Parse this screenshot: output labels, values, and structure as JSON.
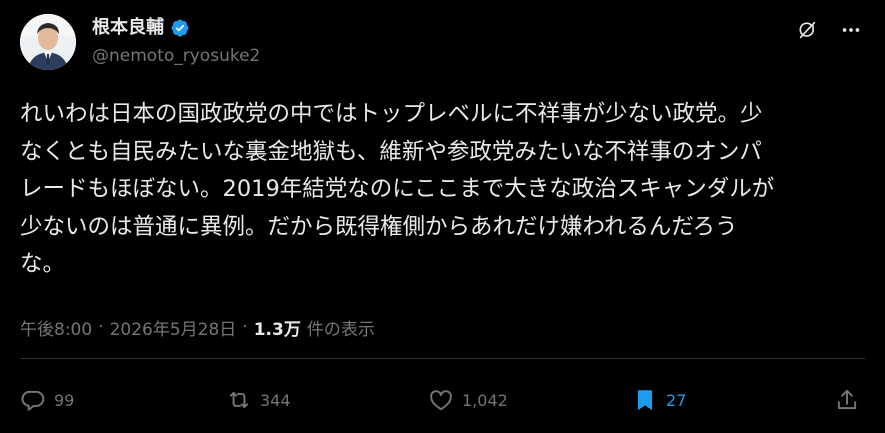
{
  "author": {
    "display_name": "根本良輔",
    "handle": "@nemoto_ryosuke2",
    "verified": true
  },
  "icons": {
    "more": "more-horizontal-icon",
    "grok": "grok-icon"
  },
  "tweet": {
    "text": "れいわは日本の国政政党の中ではトップレベルに不祥事が少ない政党。少\nなくとも自民みたいな裏金地獄も、維新や参政党みたいな不祥事のオンパ\nレードもほぼない。2019年結党なのにここまで大きな政治スキャンダルが\n少ないのは普通に異例。だから既得権側からあれだけ嫌われるんだろう\nな。"
  },
  "meta": {
    "time": "午後8:00",
    "separator1": "·",
    "date": "2026年5月28日",
    "separator2": "·",
    "views_count": "1.3万",
    "views_label": "件の表示"
  },
  "actions": {
    "replies": "99",
    "retweets": "344",
    "likes": "1,042",
    "bookmarks": "27"
  },
  "colors": {
    "background": "#000000",
    "text": "#e7e9ea",
    "secondary": "#71767b",
    "accent": "#1d9bf0",
    "divider": "#2f3336"
  }
}
